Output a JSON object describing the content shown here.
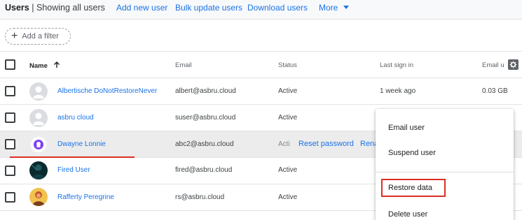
{
  "header": {
    "title": "Users",
    "subtitle": "| Showing all users",
    "links": [
      "Add new user",
      "Bulk update users",
      "Download users"
    ],
    "more_label": "More"
  },
  "filter": {
    "add_filter_label": "Add a filter"
  },
  "table": {
    "columns": {
      "name": "Name",
      "email": "Email",
      "status": "Status",
      "last_sign_in": "Last sign in",
      "storage": "Email u"
    },
    "rows": [
      {
        "name": "Albertische DoNotRestoreNever",
        "email": "albert@asbru.cloud",
        "status": "Active",
        "last_sign_in": "1 week ago",
        "storage": "0.03 GB"
      },
      {
        "name": "asbru cloud",
        "email": "suser@asbru.cloud",
        "status": "Active"
      },
      {
        "name": "Dwayne Lonnie",
        "email": "abc2@asbru.cloud",
        "status": "Acti",
        "actions": [
          "Reset password",
          "Rena"
        ]
      },
      {
        "name": "Fired User",
        "email": "fired@asbru.cloud",
        "status": "Active"
      },
      {
        "name": "Rafferty Peregrine",
        "email": "rs@asbru.cloud",
        "status": "Active"
      }
    ]
  },
  "context_menu": {
    "items": [
      "Email user",
      "Suspend user",
      "Restore data",
      "Delete user"
    ],
    "highlighted": "Restore data"
  },
  "colors": {
    "link": "#1a73e8",
    "highlight": "#d93025",
    "row_hover": "#ececec"
  },
  "icons": [
    "plus-icon",
    "sort-arrow-up-icon",
    "settings-gear-icon",
    "dropdown-caret-icon"
  ]
}
